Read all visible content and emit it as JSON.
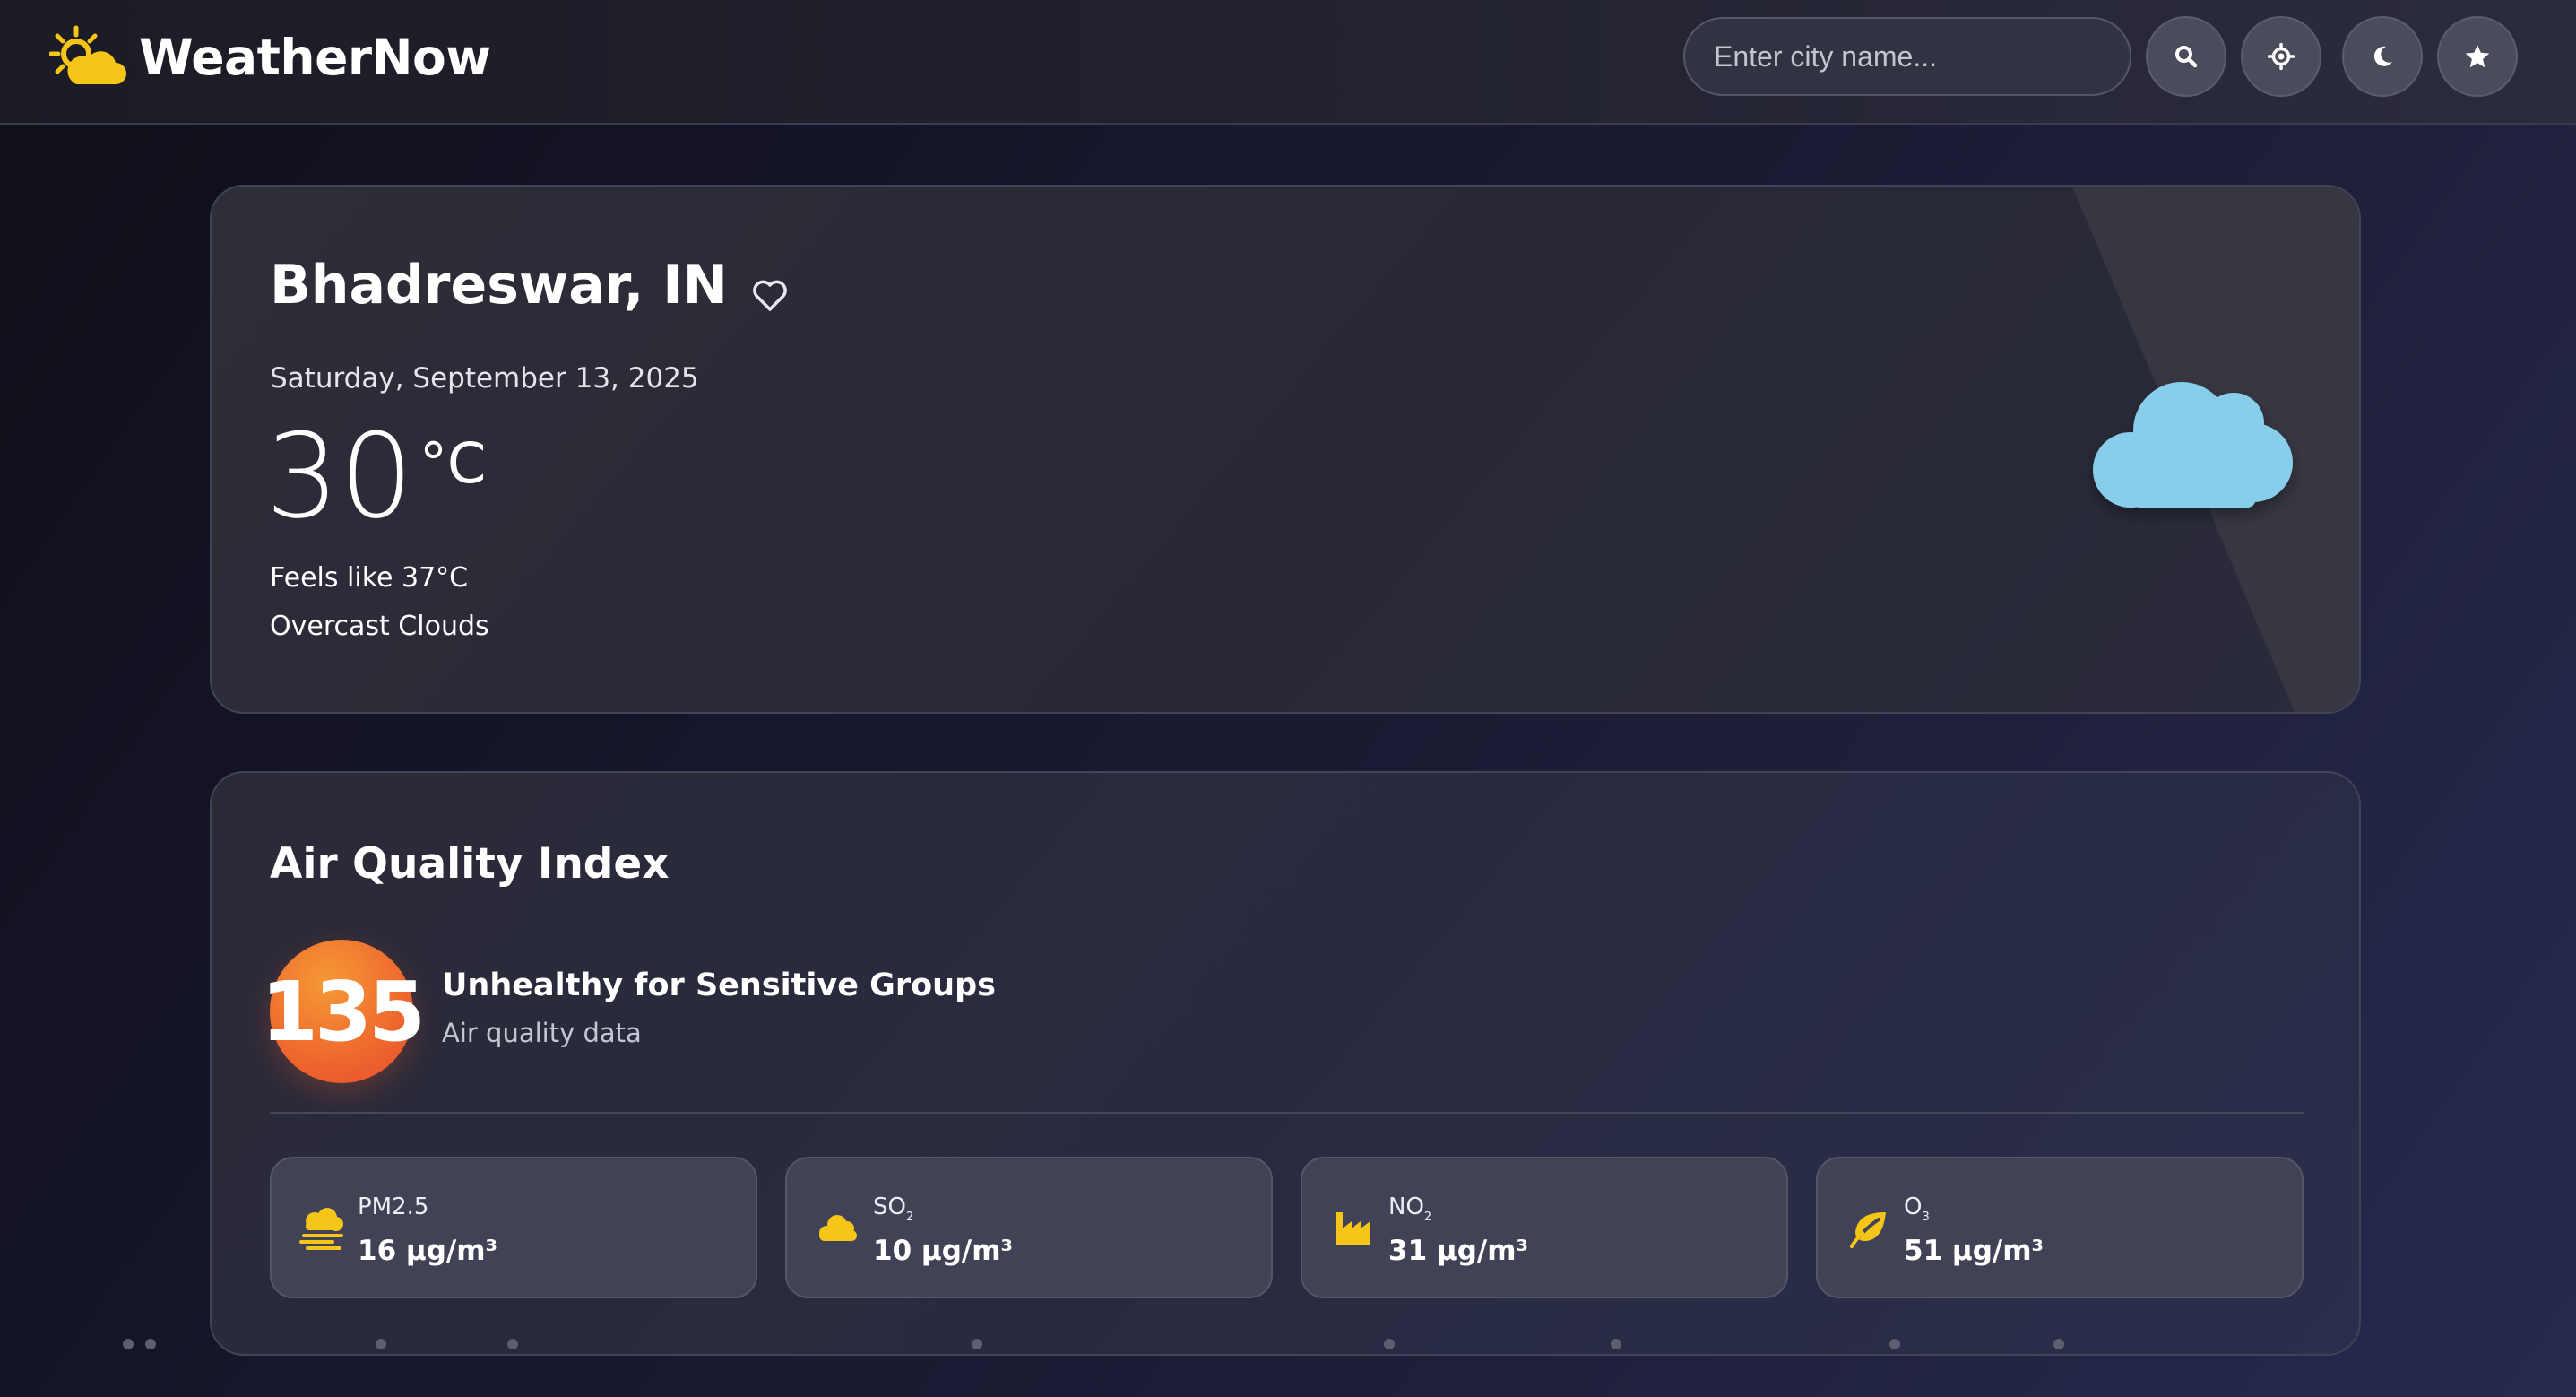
{
  "header": {
    "brand": "WeatherNow",
    "logo_icon": "sun-behind-cloud-icon",
    "search": {
      "placeholder": "Enter city name...",
      "value": ""
    },
    "buttons": [
      {
        "icon": "search-icon"
      },
      {
        "icon": "location-crosshair-icon"
      },
      {
        "icon": "moon-icon"
      },
      {
        "icon": "star-icon"
      }
    ]
  },
  "current": {
    "city": "Bhadreswar, IN",
    "date": "Saturday, September 13, 2025",
    "temperature": "30",
    "unit": "°C",
    "feels_like": "Feels like 37°C",
    "description": "Overcast Clouds",
    "condition_icon": "cloud-icon",
    "favorite_icon": "heart-outline-icon"
  },
  "air_quality": {
    "title": "Air Quality Index",
    "aqi": "135",
    "status": "Unhealthy for Sensitive Groups",
    "subtitle": "Air quality data",
    "pollutants": [
      {
        "name": "PM2.5",
        "base": "PM2.5",
        "sub": "",
        "value": "16 μg/m³",
        "icon": "smog-icon"
      },
      {
        "name": "SO₂",
        "base": "SO",
        "sub": "2",
        "value": "10 μg/m³",
        "icon": "cloud-icon"
      },
      {
        "name": "NO₂",
        "base": "NO",
        "sub": "2",
        "value": "31 μg/m³",
        "icon": "industry-icon"
      },
      {
        "name": "O₃",
        "base": "O",
        "sub": "3",
        "value": "51 μg/m³",
        "icon": "leaf-icon"
      }
    ]
  },
  "colors": {
    "accent_yellow": "#f5c518",
    "cloud_blue": "#87ceeb",
    "aqi_orange": "#ef6b2e"
  }
}
